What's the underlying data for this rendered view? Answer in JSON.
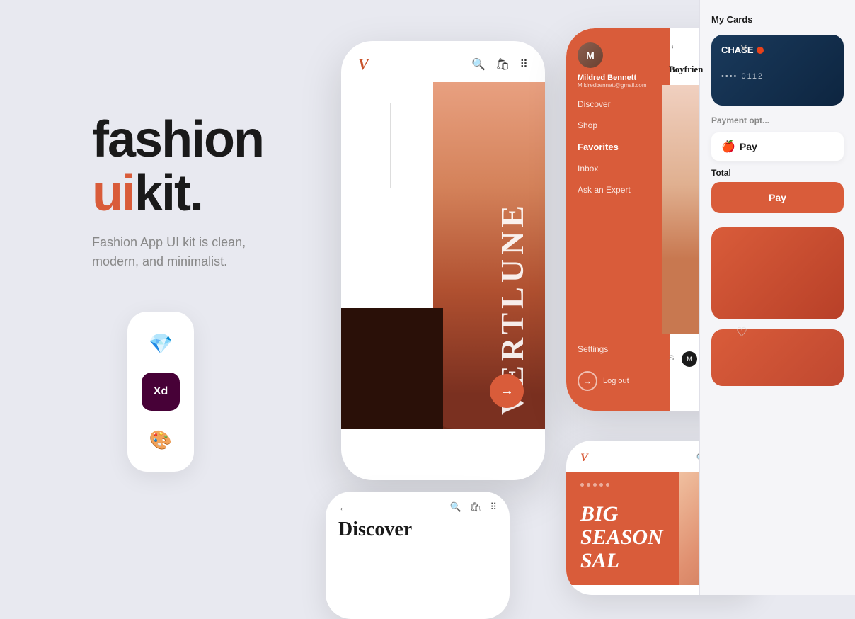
{
  "background": "#e8e9f0",
  "brand": {
    "title_part1": "fashion",
    "title_part2": "ui",
    "title_part3": "kit.",
    "description": "Fashion App UI kit is clean, modern, and minimalist."
  },
  "phone_main": {
    "logo": "V",
    "brand_name": "VERTLUNE",
    "nav_arrow": "→"
  },
  "phone_menu": {
    "user_name": "Mildred Bennett",
    "user_email": "Mildredbennett@gmail.com",
    "menu_items": [
      "Discover",
      "Shop",
      "Favorites",
      "Inbox",
      "Ask an Expert"
    ],
    "settings": "Settings",
    "logout": "Log out",
    "product_title": "Boyfrien",
    "back_arrow": "←",
    "close": "×",
    "size_s": "S",
    "size_m": "M"
  },
  "phone_mini_left": {
    "discover_text": "Discover",
    "back": "←"
  },
  "phone_mini_right": {
    "logo": "V",
    "sale_title": "BIG\nSEASON\nSAL"
  },
  "tools": [
    {
      "name": "Sketch",
      "emoji": "💎",
      "bg": "white"
    },
    {
      "name": "Adobe XD",
      "emoji": "Xd",
      "bg": "#470137"
    },
    {
      "name": "Figma",
      "emoji": "🎨",
      "bg": "white"
    }
  ],
  "right_panel": {
    "title": "My Cards",
    "card": {
      "brand": "CHASE",
      "number": "•••• 0112"
    },
    "payment_options_title": "Payment opt...",
    "apple_pay_label": "Pay",
    "total_label": "Total"
  }
}
